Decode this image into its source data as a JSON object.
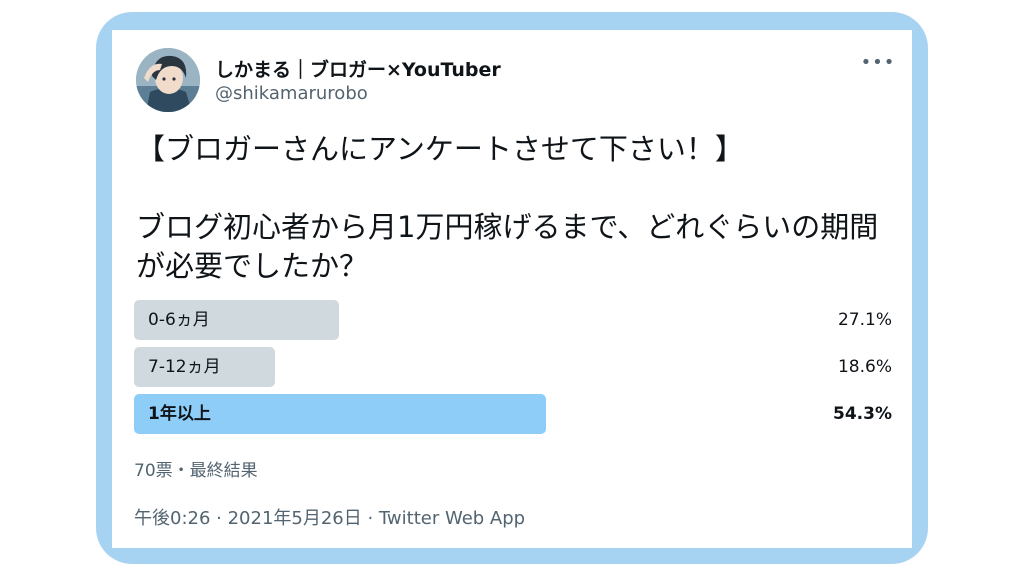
{
  "tweet": {
    "author": {
      "display_name": "しかまる｜ブロガー×YouTuber",
      "handle": "@shikamarurobo",
      "avatar": "avatar-illustration"
    },
    "more_icon": "more-horizontal-icon",
    "more_label": "•••",
    "text": {
      "line1": "【ブロガーさんにアンケートさせて下さい！】",
      "line2": "ブログ初心者から月1万円稼げるまで、どれぐらいの期間が必要でしたか？"
    },
    "poll": {
      "options": [
        {
          "label": "0-6ヵ月",
          "percent_text": "27.1%",
          "percent": 27.1,
          "winner": false
        },
        {
          "label": "7-12ヵ月",
          "percent_text": "18.6%",
          "percent": 18.6,
          "winner": false
        },
        {
          "label": "1年以上",
          "percent_text": "54.3%",
          "percent": 54.3,
          "winner": true
        }
      ],
      "summary": "70票・最終結果"
    },
    "meta": "午後0:26 · 2021年5月26日 · Twitter Web App"
  },
  "colors": {
    "frame": "#a7d3f3",
    "poll_bar": "#cfd9de",
    "poll_bar_winner": "#8ecdf7",
    "text_primary": "#0f1419",
    "text_secondary": "#536471"
  }
}
